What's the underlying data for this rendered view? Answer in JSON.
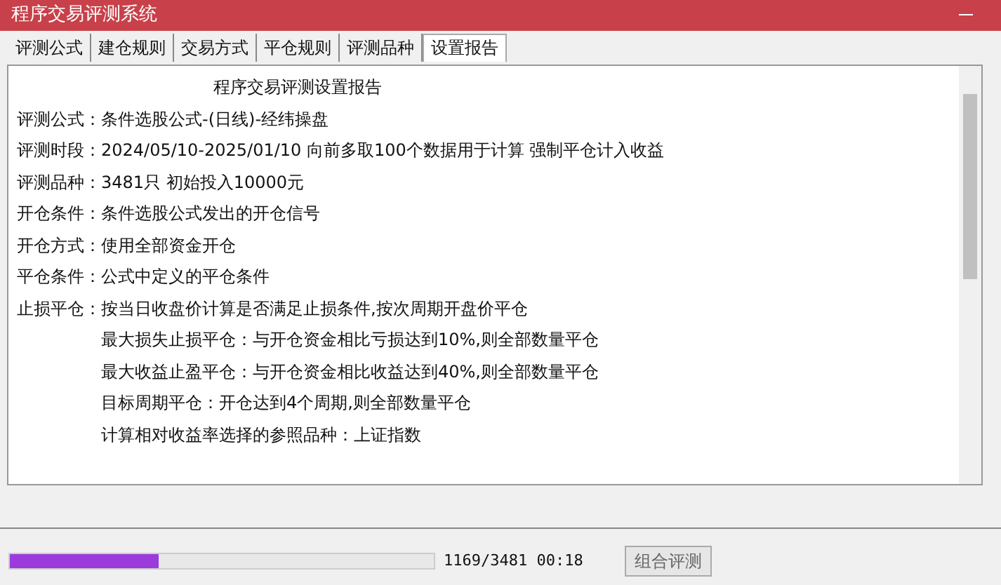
{
  "window": {
    "title": "程序交易评测系统"
  },
  "tabs": [
    {
      "label": "评测公式",
      "selected": false
    },
    {
      "label": "建仓规则",
      "selected": false
    },
    {
      "label": "交易方式",
      "selected": false
    },
    {
      "label": "平仓规则",
      "selected": false
    },
    {
      "label": "评测品种",
      "selected": false
    },
    {
      "label": "设置报告",
      "selected": true
    }
  ],
  "report": {
    "title": "程序交易评测设置报告",
    "lines": [
      {
        "kind": "field",
        "label": "评测公式：",
        "value": "条件选股公式-(日线)-经纬操盘"
      },
      {
        "kind": "field",
        "label": "评测时段：",
        "value": "2024/05/10-2025/01/10 向前多取100个数据用于计算 强制平仓计入收益"
      },
      {
        "kind": "field",
        "label": "评测品种：",
        "value": "3481只 初始投入10000元"
      },
      {
        "kind": "field",
        "label": "开仓条件：",
        "value": "条件选股公式发出的开仓信号"
      },
      {
        "kind": "field",
        "label": "开仓方式：",
        "value": "使用全部资金开仓"
      },
      {
        "kind": "field",
        "label": "平仓条件：",
        "value": "公式中定义的平仓条件"
      },
      {
        "kind": "field",
        "label": "止损平仓：",
        "value": "按当日收盘价计算是否满足止损条件,按次周期开盘价平仓"
      },
      {
        "kind": "sub",
        "value": "最大损失止损平仓：与开仓资金相比亏损达到10%,则全部数量平仓"
      },
      {
        "kind": "sub",
        "value": "最大收益止盈平仓：与开仓资金相比收益达到40%,则全部数量平仓"
      },
      {
        "kind": "sub",
        "value": "目标周期平仓：开仓达到4个周期,则全部数量平仓"
      },
      {
        "kind": "sub",
        "value": "计算相对收益率选择的参照品种：上证指数"
      }
    ]
  },
  "progress": {
    "level": 0.35,
    "reading": "1169/3481  00:18"
  },
  "buttons": [
    {
      "label": "组合评测"
    }
  ]
}
